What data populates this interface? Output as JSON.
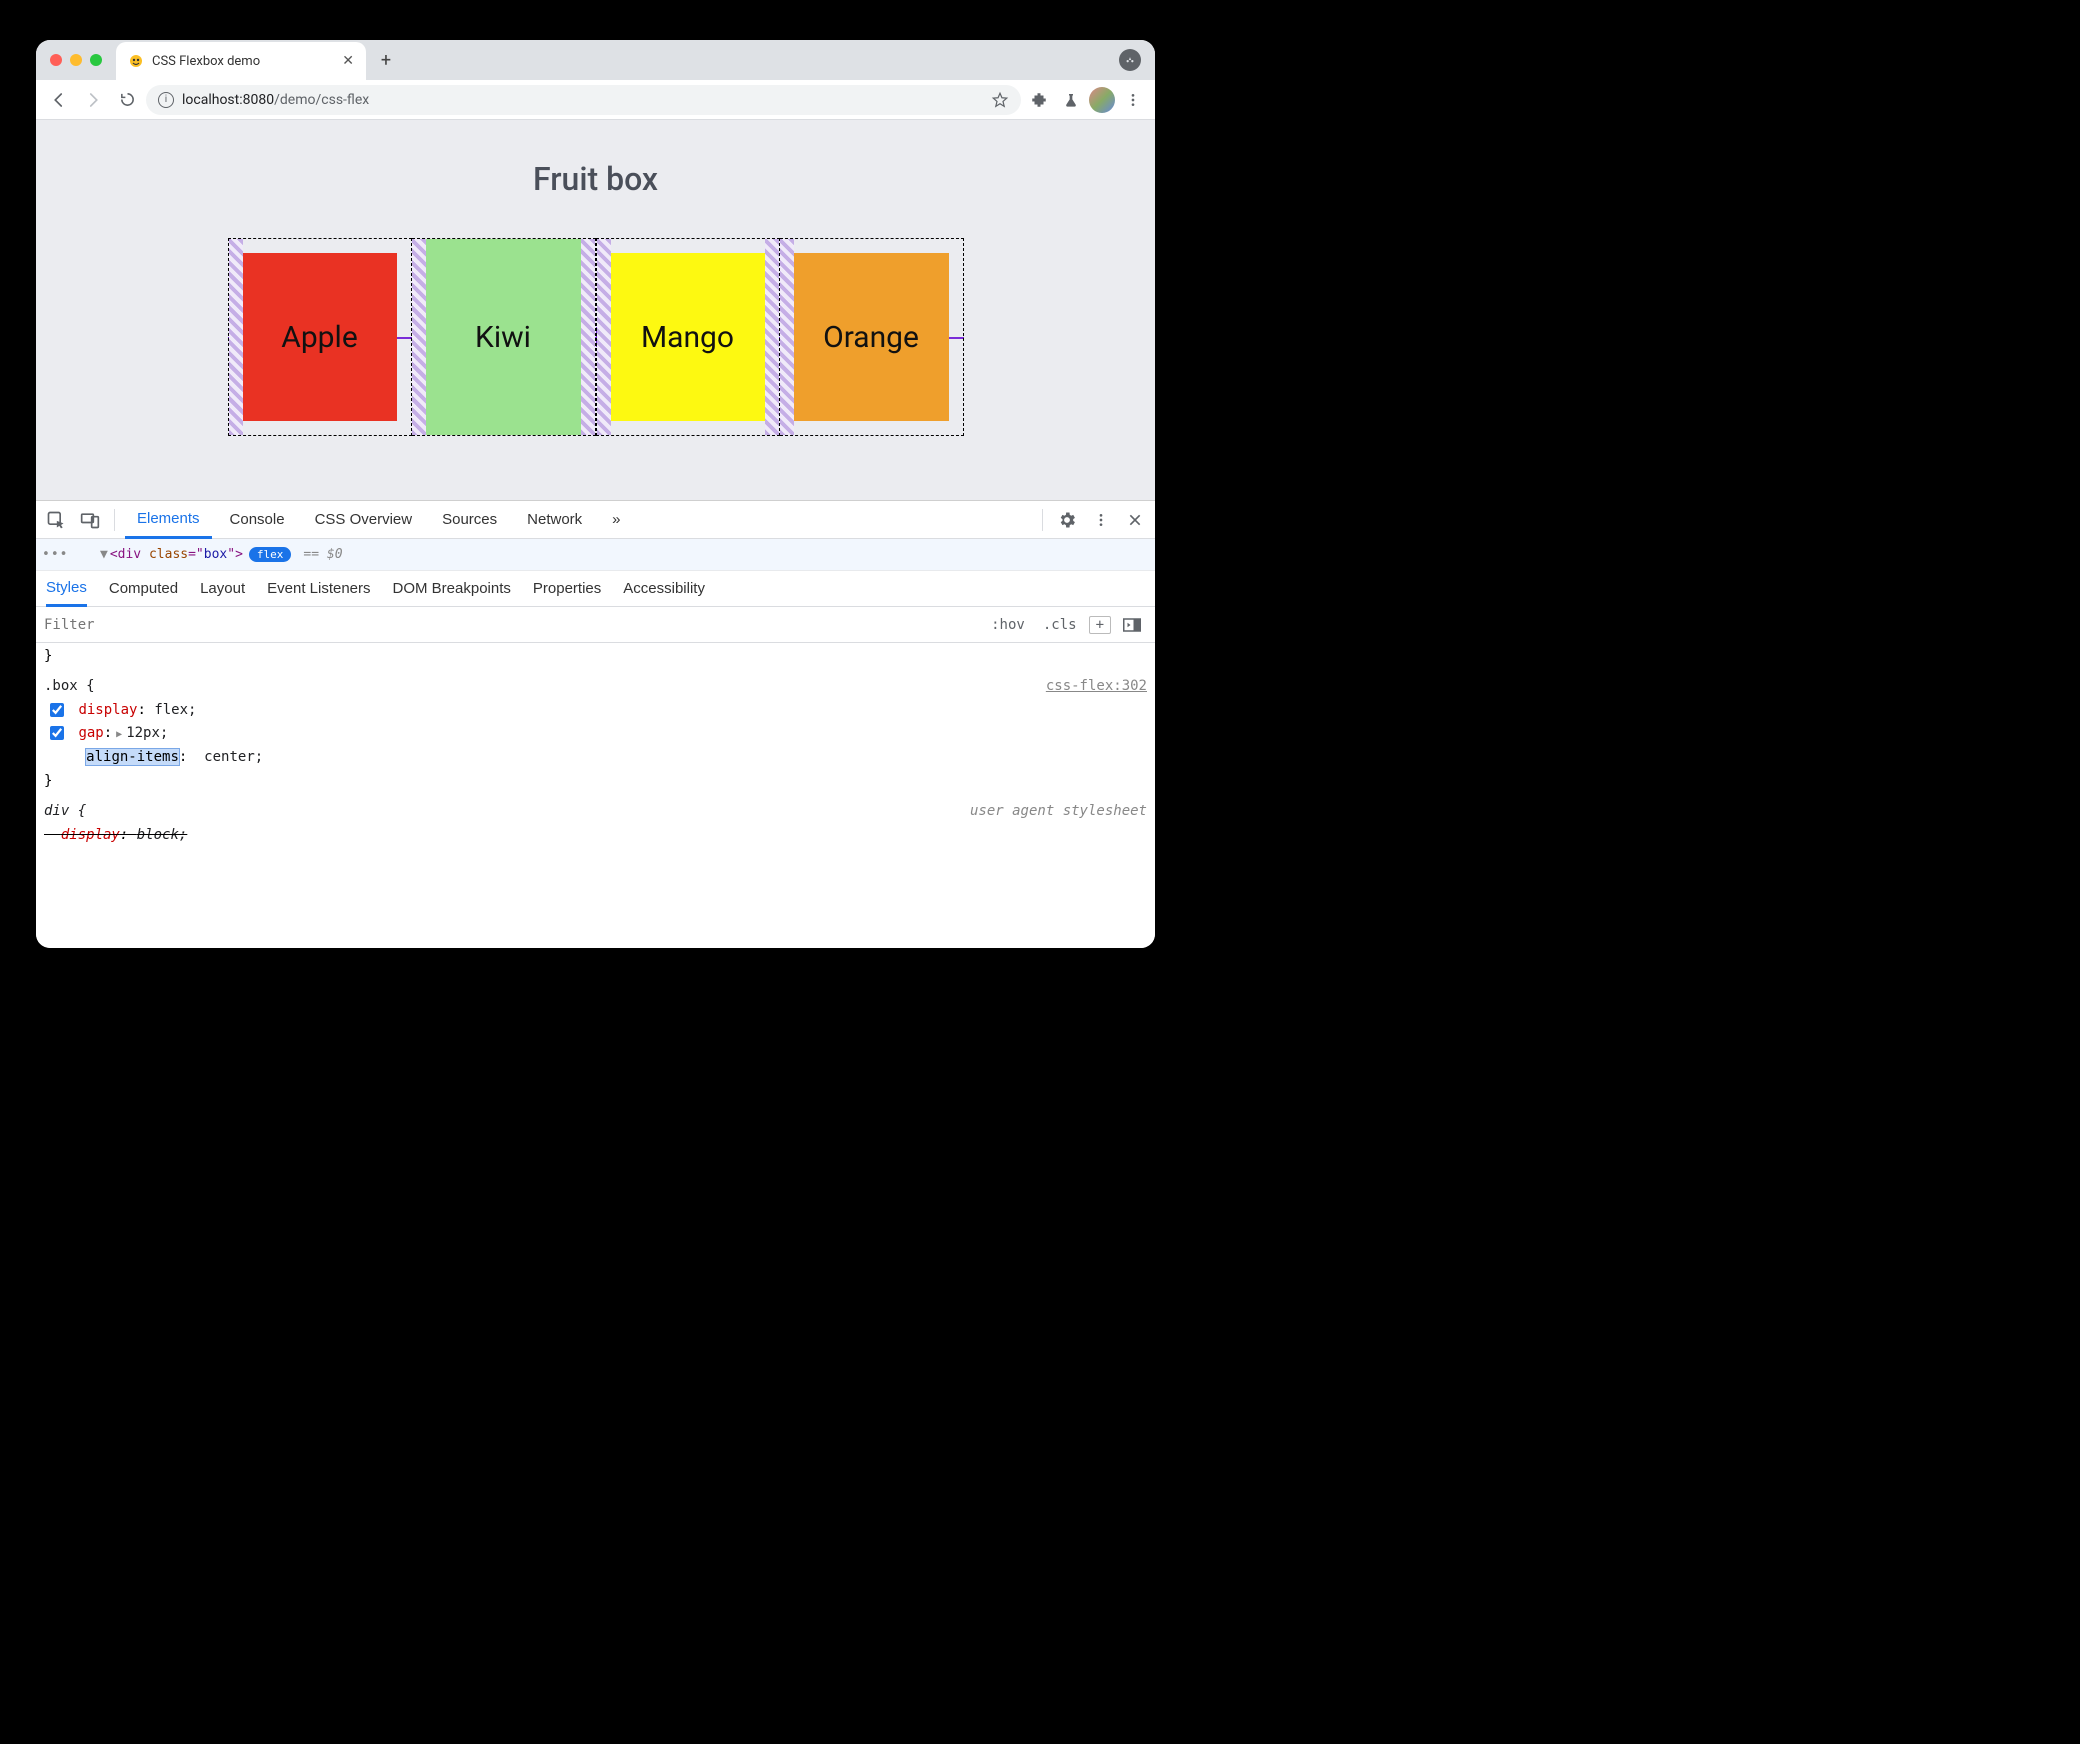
{
  "window": {
    "tab_title": "CSS Flexbox demo",
    "url_host": "localhost:",
    "url_port": "8080",
    "url_path": "/demo/css-flex"
  },
  "page": {
    "heading": "Fruit box",
    "fruits": [
      "Apple",
      "Kiwi",
      "Mango",
      "Orange"
    ]
  },
  "devtools": {
    "tabs": [
      "Elements",
      "Console",
      "CSS Overview",
      "Sources",
      "Network"
    ],
    "more_tabs_glyph": "»",
    "dom": {
      "tag": "div",
      "class_attr": "class",
      "class_val": "box",
      "chip": "flex",
      "eq": "== $0"
    },
    "sub_tabs": [
      "Styles",
      "Computed",
      "Layout",
      "Event Listeners",
      "DOM Breakpoints",
      "Properties",
      "Accessibility"
    ],
    "styles_filter_placeholder": "Filter",
    "hov": ":hov",
    "cls": ".cls",
    "close_brace": "}",
    "rule_box": {
      "selector": ".box {",
      "source": "css-flex:302",
      "p1_prop": "display",
      "p1_val": "flex;",
      "p2_prop": "gap",
      "p2_expander": "▶",
      "p2_val": "12px;",
      "p3_prop": "align-items",
      "p3_val": "center;",
      "close": "}"
    },
    "rule_ua": {
      "selector": "div {",
      "source": "user agent stylesheet",
      "p1_prop": "display",
      "p1_val": "block;"
    }
  }
}
